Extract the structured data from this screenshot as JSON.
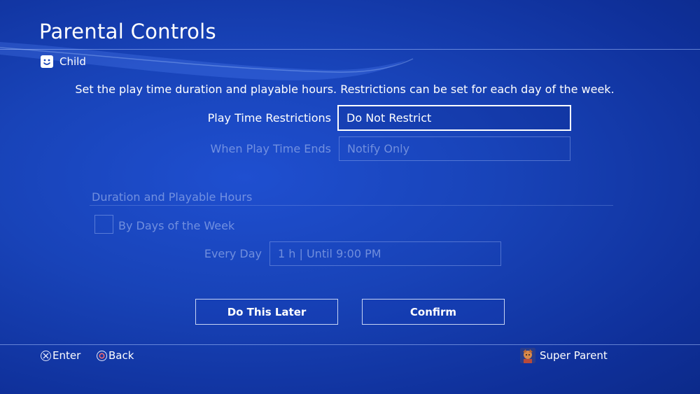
{
  "header": {
    "title": "Parental Controls"
  },
  "profile": {
    "name": "Child",
    "icon": "smiley-face-icon"
  },
  "description": "Set the play time duration and playable hours. Restrictions can be set for each day of the week.",
  "settings": {
    "play_time_restrictions": {
      "label": "Play Time Restrictions",
      "value": "Do Not Restrict"
    },
    "when_play_time_ends": {
      "label": "When Play Time Ends",
      "value": "Notify Only"
    }
  },
  "duration_section": {
    "title": "Duration and Playable Hours",
    "by_days_checkbox": {
      "label": "By Days of the Week",
      "checked": false
    },
    "every_day": {
      "label": "Every Day",
      "value": "1 h | Until 9:00 PM"
    }
  },
  "buttons": {
    "later": "Do This Later",
    "confirm": "Confirm"
  },
  "footer": {
    "enter": {
      "label": "Enter",
      "icon": "cross-button-icon"
    },
    "back": {
      "label": "Back",
      "icon": "circle-button-icon"
    },
    "user": {
      "name": "Super Parent",
      "icon": "user-avatar"
    }
  },
  "colors": {
    "background": "#1843b8",
    "text": "#ffffff",
    "disabled_text": "#aabef0"
  }
}
